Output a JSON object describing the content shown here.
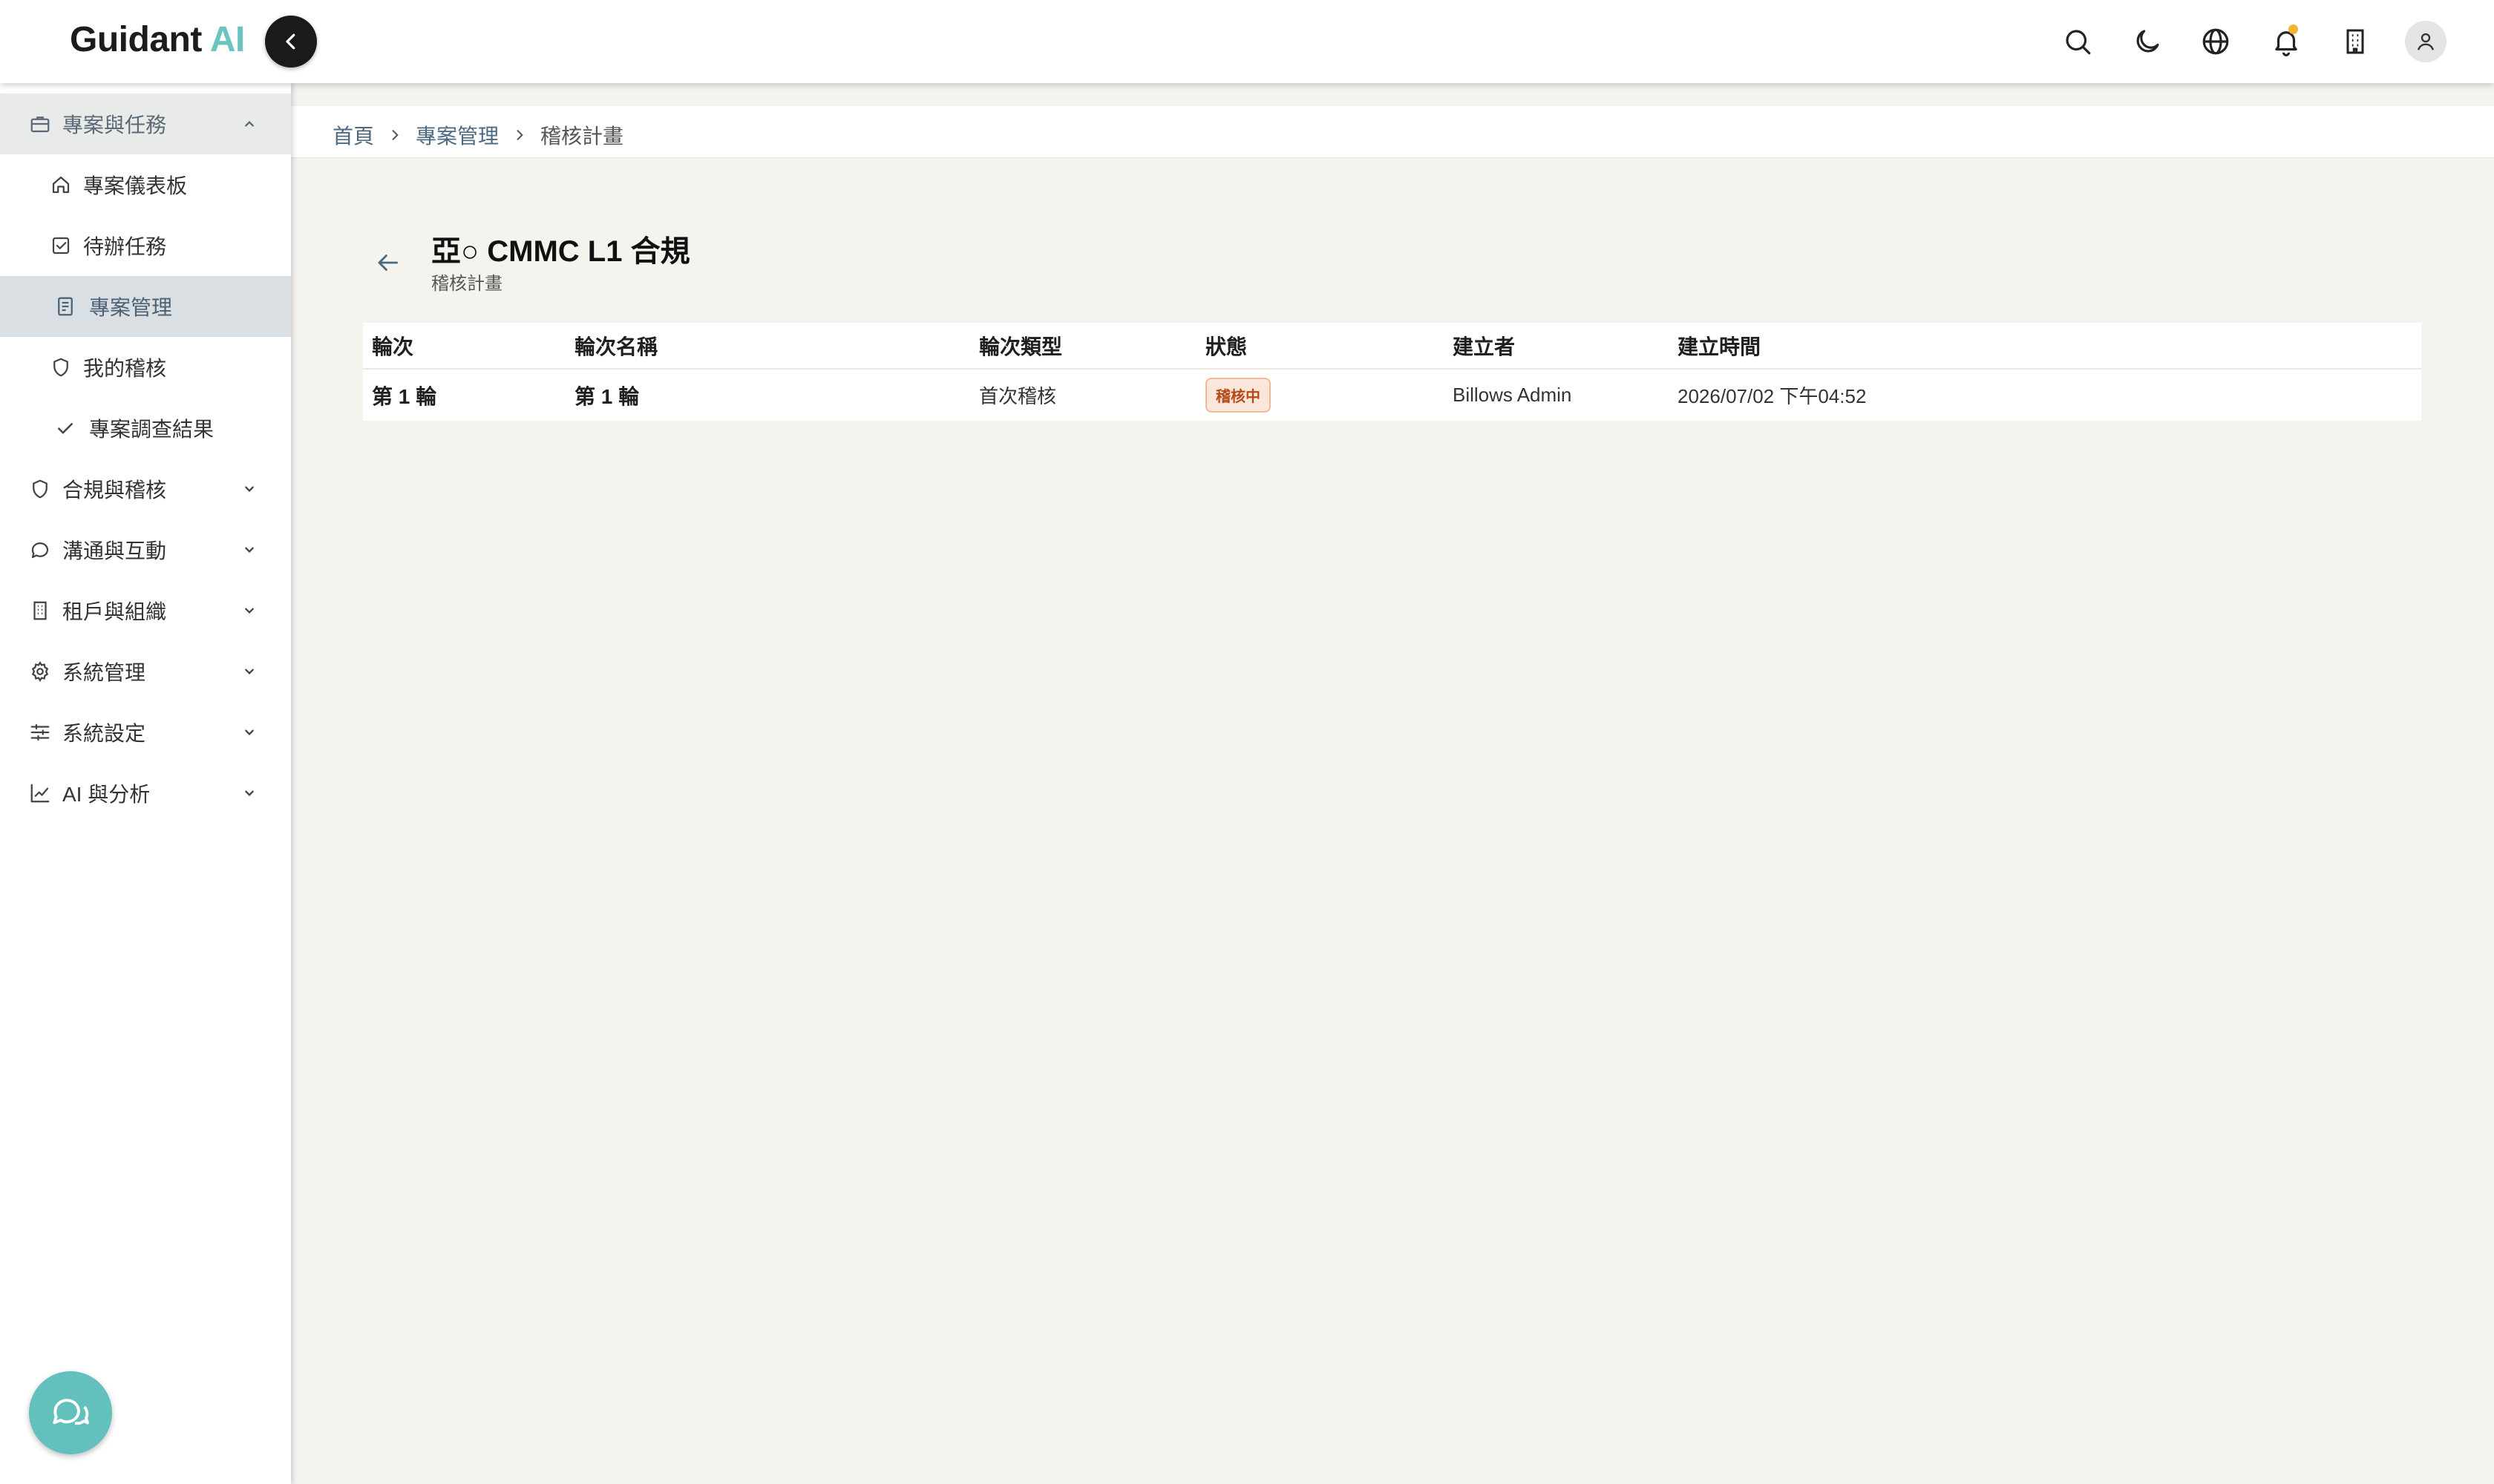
{
  "header": {
    "logo_text": "Guidant",
    "logo_accent": "AI",
    "icons": [
      "search-icon",
      "moon-icon",
      "globe-icon",
      "bell-icon",
      "building-icon",
      "user-icon"
    ],
    "accent_color": "#6cc3c0",
    "notification_dot_color": "#f2b431"
  },
  "sidebar": {
    "sections": [
      {
        "label": "專案與任務",
        "icon": "briefcase-icon",
        "expanded": true,
        "items": [
          {
            "label": "專案儀表板",
            "icon": "home-icon"
          },
          {
            "label": "待辦任務",
            "icon": "checkbox-icon"
          },
          {
            "label": "專案管理",
            "icon": "document-icon",
            "active": true
          },
          {
            "label": "我的稽核",
            "icon": "shield-icon"
          },
          {
            "label": "專案調查結果",
            "icon": "check-icon"
          }
        ]
      },
      {
        "label": "合規與稽核",
        "icon": "shield-icon"
      },
      {
        "label": "溝通與互動",
        "icon": "chat-icon"
      },
      {
        "label": "租戶與組織",
        "icon": "building-icon"
      },
      {
        "label": "系統管理",
        "icon": "gear-icon"
      },
      {
        "label": "系統設定",
        "icon": "sliders-icon"
      },
      {
        "label": "AI 與分析",
        "icon": "chart-line-icon"
      }
    ]
  },
  "breadcrumb": {
    "items": [
      "首頁",
      "專案管理"
    ],
    "current": "稽核計畫"
  },
  "page": {
    "title": "亞○ CMMC L1 合規",
    "subtitle": "稽核計畫"
  },
  "table": {
    "columns": [
      "輪次",
      "輪次名稱",
      "輪次類型",
      "狀態",
      "建立者",
      "建立時間"
    ],
    "rows": [
      {
        "round": "第 1 輪",
        "round_name": "第 1 輪",
        "round_type": "首次稽核",
        "status": "稽核中",
        "creator": "Billows Admin",
        "created_at": "2026/07/02 下午04:52"
      }
    ]
  }
}
